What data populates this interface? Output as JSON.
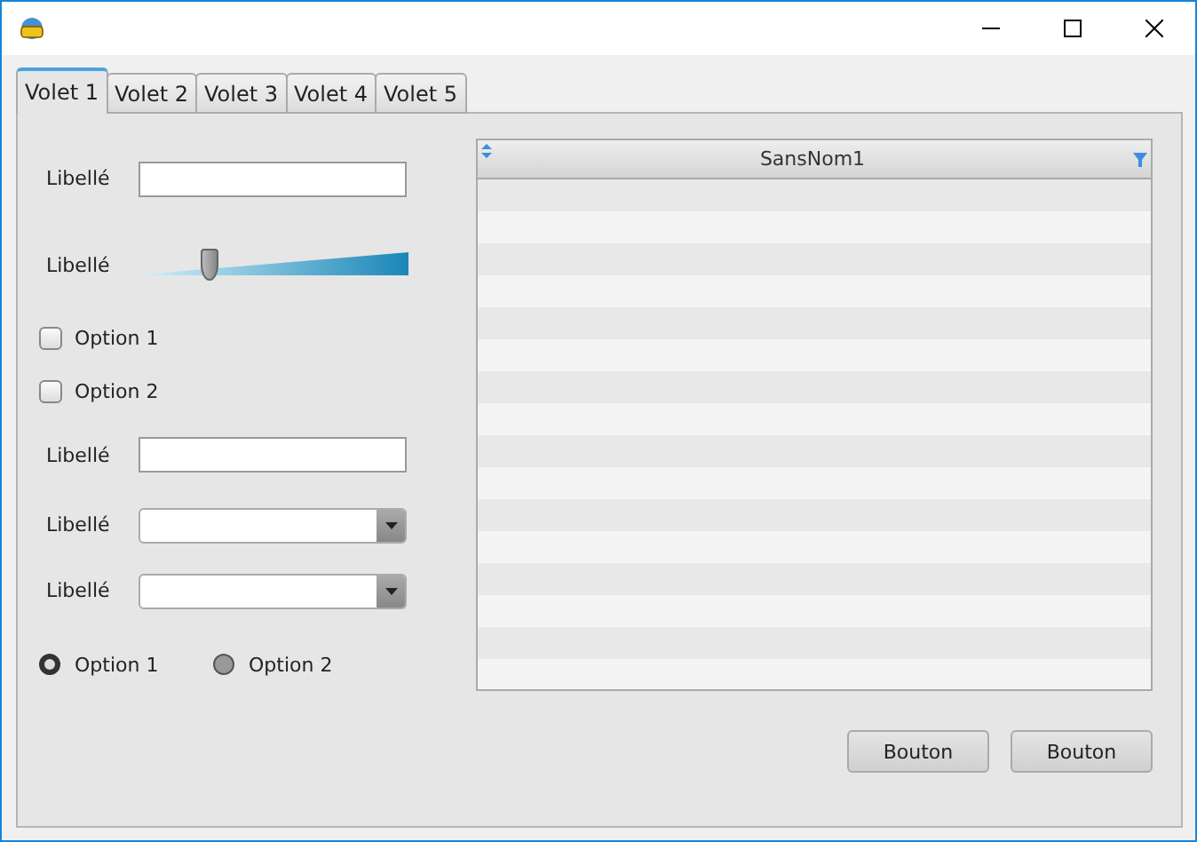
{
  "tabs": [
    {
      "label": "Volet 1",
      "selected": true
    },
    {
      "label": "Volet 2",
      "selected": false
    },
    {
      "label": "Volet 3",
      "selected": false
    },
    {
      "label": "Volet 4",
      "selected": false
    },
    {
      "label": "Volet 5",
      "selected": false
    }
  ],
  "form": [
    {
      "kind": "text",
      "label": "Libellé"
    },
    {
      "kind": "slider",
      "label": "Libellé",
      "level": 0.28
    },
    {
      "kind": "checkbox",
      "label": "Option 1",
      "checked": false
    },
    {
      "kind": "checkbox",
      "label": "Option 2",
      "checked": false
    },
    {
      "kind": "text",
      "label": "Libellé"
    },
    {
      "kind": "combo",
      "label": "Libellé"
    },
    {
      "kind": "combo",
      "label": "Libellé"
    },
    {
      "kind": "radios",
      "options": [
        {
          "label": "Option 1",
          "selected": true
        },
        {
          "label": "Option 2",
          "selected": false
        }
      ]
    }
  ],
  "table": {
    "columns": [
      "SansNom1"
    ]
  },
  "buttons": [
    "Bouton",
    "Bouton"
  ]
}
